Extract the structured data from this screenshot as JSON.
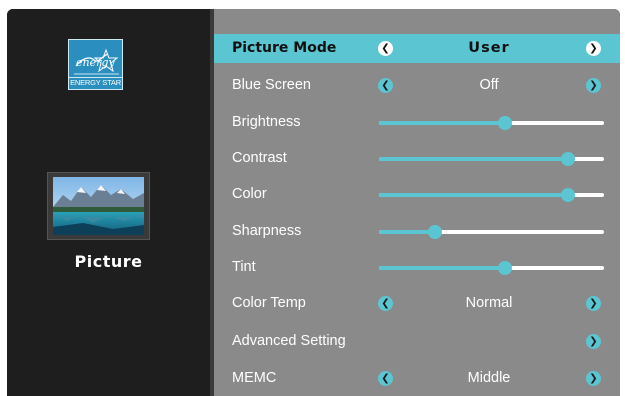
{
  "sidebar": {
    "energy_star_label": "ENERGY STAR",
    "energy_star_script": "energy",
    "section_title": "Picture"
  },
  "menu": [
    {
      "label": "Picture Mode",
      "type": "option",
      "value": "User",
      "selected": true
    },
    {
      "label": "Blue Screen",
      "type": "option",
      "value": "Off"
    },
    {
      "label": "Brightness",
      "type": "slider",
      "level": 0.56
    },
    {
      "label": "Contrast",
      "type": "slider",
      "level": 0.84
    },
    {
      "label": "Color",
      "type": "slider",
      "level": 0.84
    },
    {
      "label": "Sharpness",
      "type": "slider",
      "level": 0.25
    },
    {
      "label": "Tint",
      "type": "slider",
      "level": 0.56
    },
    {
      "label": "Color Temp",
      "type": "option",
      "value": "Normal"
    },
    {
      "label": "Advanced Setting",
      "type": "submenu"
    },
    {
      "label": "MEMC",
      "type": "option",
      "value": "Middle"
    }
  ],
  "icons": {
    "left_arrow": "chevron-left-icon",
    "right_arrow": "chevron-right-icon"
  },
  "colors": {
    "accent": "#5bc6d2",
    "panel_dark": "#1e1e1e",
    "panel_gray": "#8a8a8a"
  }
}
